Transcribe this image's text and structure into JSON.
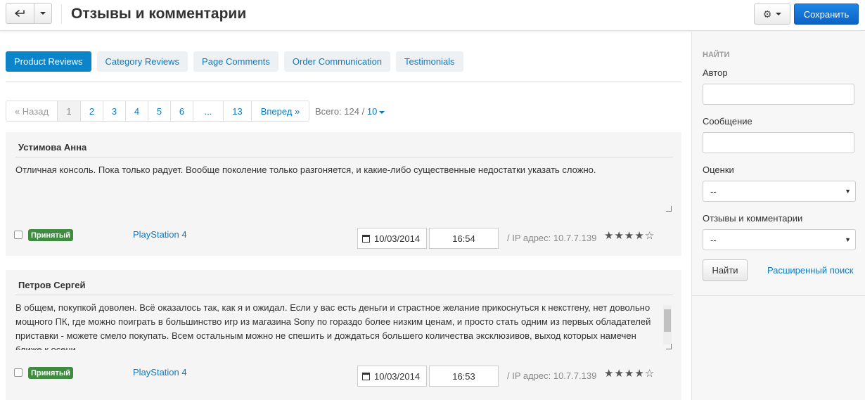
{
  "header": {
    "title": "Отзывы и комментарии",
    "save_label": "Сохранить",
    "back_icon": "back-arrow-icon",
    "settings_icon": "gear-icon"
  },
  "tabs": [
    {
      "label": "Product Reviews",
      "active": true
    },
    {
      "label": "Category Reviews",
      "active": false
    },
    {
      "label": "Page Comments",
      "active": false
    },
    {
      "label": "Order Communication",
      "active": false
    },
    {
      "label": "Testimonials",
      "active": false
    }
  ],
  "pagination": {
    "prev": "« Назад",
    "pages": [
      "1",
      "2",
      "3",
      "4",
      "5",
      "6",
      "...",
      "13"
    ],
    "current": "1",
    "next": "Вперед »",
    "total_label": "Всего: 124 /",
    "per_page": "10"
  },
  "reviews": [
    {
      "author": "Устимова Анна",
      "text": "Отличная консоль. Пока только радует. Вообще поколение только разгоняется, и какие-либо существенные недостатки указать сложно.",
      "status": "Принятый",
      "product": "PlayStation 4",
      "date": "10/03/2014",
      "time": "16:54",
      "ip": "/ IP адрес: 10.7.7.139",
      "rating": 4,
      "max_rating": 5
    },
    {
      "author": "Петров Сергей",
      "text": "В общем, покупкой доволен. Всё оказалось так, как я и ожидал. Если у вас есть деньги и страстное желание прикоснуться к некстгену, нет довольно мощного ПК, где можно поиграть в большинство игр из магазина Sony по гораздо более низким ценам, и просто стать одним из первых обладателей приставки - можете смело покупать. Всем остальным можно не спешить и дождаться большего количества эксклюзивов, выход которых намечен ближе к осени.",
      "status": "Принятый",
      "product": "PlayStation 4",
      "date": "10/03/2014",
      "time": "16:53",
      "ip": "/ IP адрес: 10.7.7.139",
      "rating": 4,
      "max_rating": 5
    }
  ],
  "sidebar": {
    "heading": "НАЙТИ",
    "author_label": "Автор",
    "author_value": "",
    "message_label": "Сообщение",
    "message_value": "",
    "rating_label": "Оценки",
    "rating_value": "--",
    "type_label": "Отзывы и комментарии",
    "type_value": "--",
    "find_label": "Найти",
    "advanced_label": "Расширенный поиск"
  },
  "colors": {
    "accent": "#0b84c9",
    "link": "#0b7ac1",
    "save": "#0c62c5",
    "status_badge": "#3f8b3f"
  }
}
